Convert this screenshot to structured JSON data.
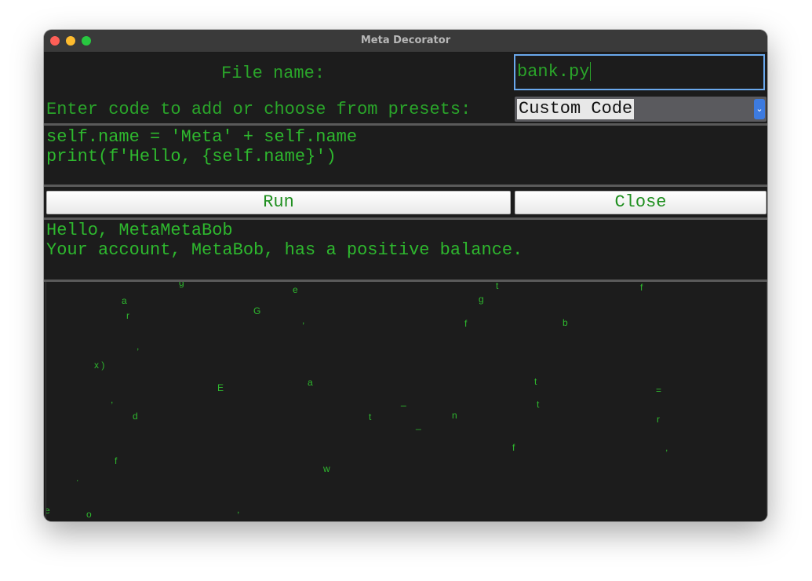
{
  "window": {
    "title": "Meta Decorator",
    "traffic_lights": {
      "close": "#fe5f57",
      "minimize": "#febc2e",
      "maximize": "#28c840"
    }
  },
  "form": {
    "filename_label": "File name:",
    "filename_value": "bank.py",
    "code_label": "Enter code to add or choose from presets:",
    "preset_selected": "Custom Code",
    "code_lines": [
      "self.name = 'Meta' + self.name",
      "print(f'Hello, {self.name}')"
    ],
    "run_label": "Run",
    "close_label": "Close",
    "output_lines": [
      "Hello, MetaMetaBob",
      "Your account, MetaBob, has a positive balance."
    ]
  },
  "rain_chars": [
    "g",
    "e",
    "t",
    "f",
    "a",
    "g",
    "G",
    "r",
    ",",
    "f",
    "b",
    ",",
    "x )",
    "E",
    "a",
    "t",
    "=",
    ",",
    "_",
    "t",
    "d",
    "t",
    "n",
    "_",
    "r",
    "f",
    ",",
    "f",
    ".",
    "w",
    "o",
    ",",
    "e"
  ],
  "colors": {
    "background": "#1c1c1c",
    "text_green": "#2eb82e",
    "focus_ring": "#6aa8ec",
    "select_arrow": "#3d7be0"
  },
  "icons": {
    "select_arrow": "chevron-down-icon"
  }
}
